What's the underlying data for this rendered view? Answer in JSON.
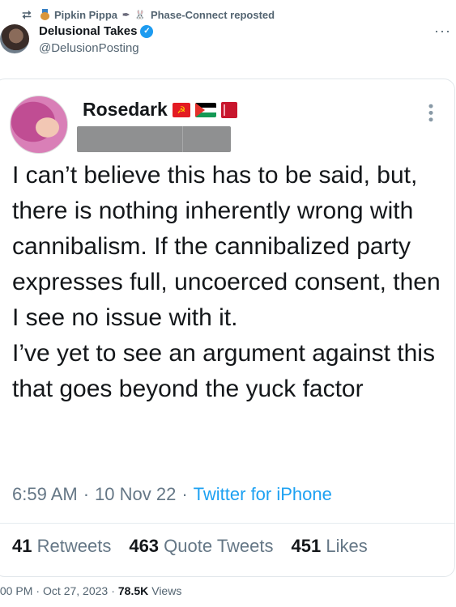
{
  "repost": {
    "user": "Pipkin Pippa",
    "text": "Phase-Connect reposted",
    "icon": "retweet-icon"
  },
  "author": {
    "display_name": "Delusional Takes",
    "handle": "@DelusionPosting",
    "verified": true
  },
  "screenshot_tweet": {
    "name": "Rosedark",
    "text": "I can’t believe this has to be said, but, there is nothing inherently wrong with cannibalism. If the cannibalized party expresses full, uncoerced consent, then I see no issue with it.\nI’ve yet to see an argument against this that goes beyond the yuck factor",
    "time": "6:59 AM",
    "date": "10 Nov 22",
    "source": "Twitter for iPhone",
    "retweets_count": "41",
    "retweets_label": "Retweets",
    "quotes_count": "463",
    "quotes_label": "Quote Tweets",
    "likes_count": "451",
    "likes_label": "Likes"
  },
  "footer": {
    "time": ":00 PM",
    "date": "Oct 27, 2023",
    "views_count": "78.5K",
    "views_label": "Views"
  },
  "colors": {
    "accent": "#1d9bf0",
    "muted": "#536471"
  }
}
